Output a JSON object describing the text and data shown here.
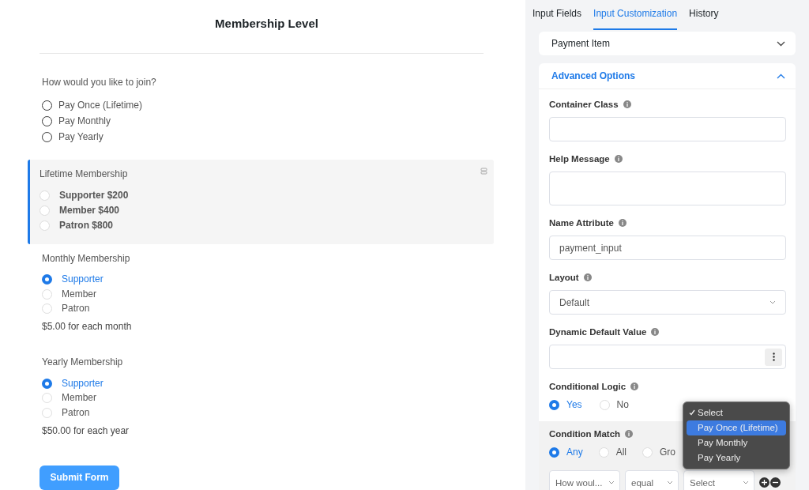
{
  "form": {
    "title": "Membership Level",
    "question": {
      "label": "How would you like to join?",
      "options": [
        {
          "label": "Pay Once (Lifetime)",
          "selected": false
        },
        {
          "label": "Pay Monthly",
          "selected": false
        },
        {
          "label": "Pay Yearly",
          "selected": false
        }
      ]
    },
    "groups": [
      {
        "title": "Lifetime Membership",
        "highlighted": true,
        "options": [
          {
            "label": "Supporter $200",
            "selected": false
          },
          {
            "label": "Member $400",
            "selected": false
          },
          {
            "label": "Patron $800",
            "selected": false
          }
        ]
      },
      {
        "title": "Monthly Membership",
        "highlighted": false,
        "options": [
          {
            "label": "Supporter",
            "selected": true
          },
          {
            "label": "Member",
            "selected": false
          },
          {
            "label": "Patron",
            "selected": false
          }
        ],
        "price": "$5.00 for each month"
      },
      {
        "title": "Yearly Membership",
        "highlighted": false,
        "options": [
          {
            "label": "Supporter",
            "selected": true
          },
          {
            "label": "Member",
            "selected": false
          },
          {
            "label": "Patron",
            "selected": false
          }
        ],
        "price": "$50.00 for each year"
      }
    ],
    "submit": "Submit Form"
  },
  "settings": {
    "tabs": [
      {
        "label": "Input Fields",
        "selected": false
      },
      {
        "label": "Input Customization",
        "selected": true
      },
      {
        "label": "History",
        "selected": false
      }
    ],
    "sections": [
      {
        "title": "Payment Item",
        "expanded": false
      },
      {
        "title": "Advanced Options",
        "expanded": true
      }
    ],
    "fields": [
      {
        "kind": "input",
        "label": "Container Class"
      },
      {
        "kind": "textarea",
        "label": "Help Message"
      },
      {
        "kind": "input",
        "label": "Name Attribute",
        "value": "payment_input"
      },
      {
        "kind": "select",
        "label": "Layout",
        "value": "Default"
      },
      {
        "kind": "menu-input",
        "label": "Dynamic Default Value"
      },
      {
        "kind": "radio",
        "label": "Conditional Logic",
        "options": [
          {
            "label": "Yes",
            "selected": true
          },
          {
            "label": "No",
            "selected": false
          }
        ]
      }
    ],
    "condition": {
      "label": "Condition Match",
      "options": [
        {
          "label": "Any",
          "selected": true
        },
        {
          "label": "All",
          "selected": false
        },
        {
          "label": "Gro",
          "selected": false
        }
      ],
      "rule": {
        "field": "How woul...",
        "operator": "equal",
        "value": "Select"
      },
      "dropdown": [
        {
          "label": "Select",
          "checked": true,
          "selected": false
        },
        {
          "label": "Pay Once (Lifetime)",
          "checked": false,
          "selected": true
        },
        {
          "label": "Pay Monthly",
          "checked": false,
          "selected": false
        },
        {
          "label": "Pay Yearly",
          "checked": false,
          "selected": false
        }
      ]
    }
  }
}
